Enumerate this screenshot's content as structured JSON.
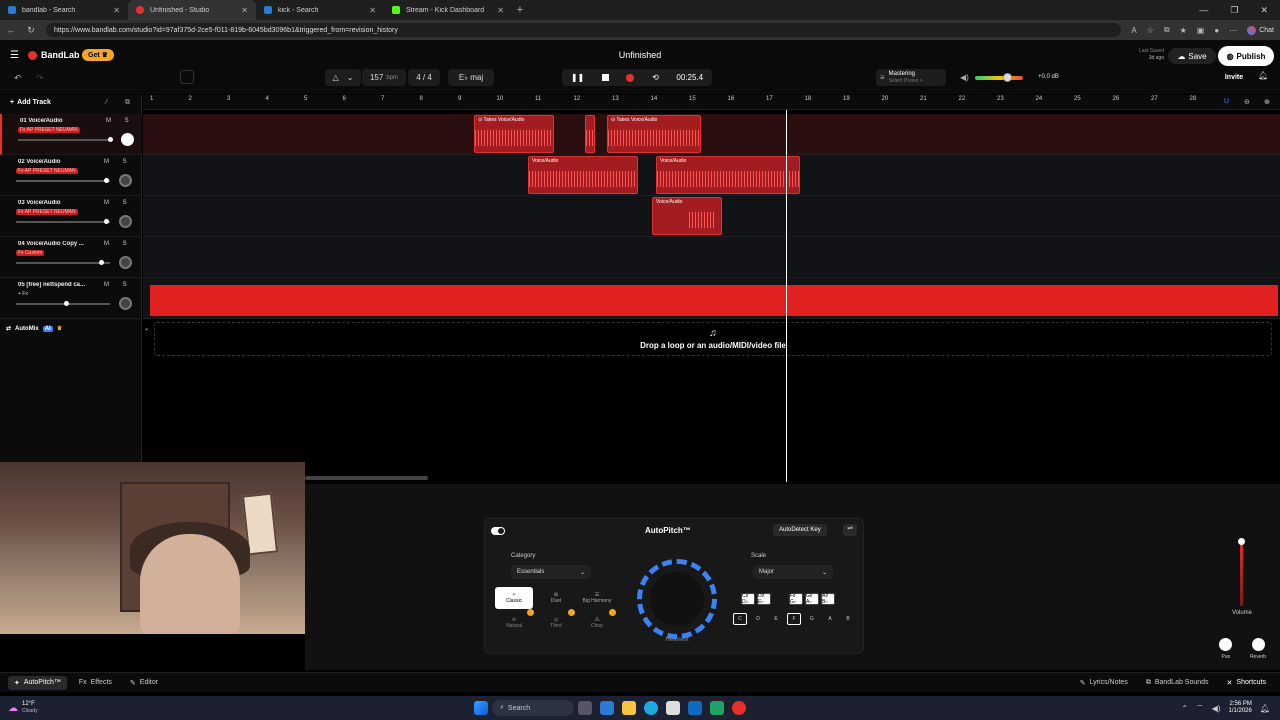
{
  "browser": {
    "tabs": [
      {
        "label": "bandlab - Search",
        "active": false
      },
      {
        "label": "Unfinished - Studio",
        "active": true
      },
      {
        "label": "kick - Search",
        "active": false
      },
      {
        "label": "Stream - Kick Dashboard",
        "active": false
      }
    ],
    "url": "https://www.bandlab.com/studio?id=97af375d-2ce5-f011-819b-6045bd3096b1&triggered_from=revision_history",
    "chat_label": "Chat"
  },
  "header": {
    "brand": "BandLab",
    "get_label": "Get",
    "project_title": "Unfinished",
    "bpm_value": "157",
    "bpm_unit": "bpm",
    "time_signature": "4 / 4",
    "key": "E♭ maj",
    "time_display": "00:25.4",
    "mastering_label": "Mastering",
    "mastering_sub": "Select Preset >",
    "master_db": "+0.0 dB",
    "last_saved_label": "Last Saved",
    "last_saved_value": "3d ago",
    "save_label": "Save",
    "publish_label": "Publish",
    "invite_label": "Invite",
    "accent": "#e5302d"
  },
  "tracks_panel": {
    "add_track_label": "Add Track",
    "tracks": [
      {
        "name": "01  Voice/Audio",
        "fx": "Fx  AP PRESET NEUMAN"
      },
      {
        "name": "02  Voice/Audio",
        "fx": "Fx  AP PRESET NEUMAN"
      },
      {
        "name": "03  Voice/Audio",
        "fx": "Fx  AP PRESET NEUMAN"
      },
      {
        "name": "04  Voice/Audio Copy ...",
        "fx": "Fx  Custom"
      },
      {
        "name": "05  [free] nettspend ca...",
        "fx": "+ Fx"
      }
    ],
    "mute_solo": "M S",
    "automix_label": "AutoMix",
    "automix_badge": "AI"
  },
  "ruler": {
    "bars": [
      "1",
      "2",
      "3",
      "4",
      "5",
      "6",
      "7",
      "8",
      "9",
      "10",
      "11",
      "12",
      "13",
      "14",
      "15",
      "16",
      "17",
      "18",
      "19",
      "20",
      "21",
      "22",
      "23",
      "24",
      "25",
      "26",
      "27",
      "28"
    ]
  },
  "clips": {
    "takes_label": "Takes",
    "voice_label": "Voice/Audio"
  },
  "dropzone": {
    "text": "Drop a loop or an audio/MIDI/video file"
  },
  "autopitch": {
    "title": "AutoPitch™",
    "autodetect_label": "AutoDetect Key",
    "category_label": "Category",
    "category_value": "Essentials",
    "scale_label": "Scale",
    "scale_value": "Major",
    "knob_caption": "Heaviest",
    "styles": [
      "Classic",
      "Duet",
      "Big Harmony",
      "Natural",
      "Third",
      "Chop"
    ],
    "keys_top": [
      "C♯ D♭",
      "D♯ E♭",
      "F♯ G♭",
      "G♯ A♭",
      "A♯ B♭"
    ],
    "keys_bottom": [
      "C",
      "D",
      "E",
      "F",
      "G",
      "A",
      "B"
    ],
    "volume_label": "Volume",
    "pan_label": "Pan",
    "reverb_label": "Reverb"
  },
  "bottom_bar": {
    "autopitch_tab": "AutoPitch™",
    "effects_tab": "Effects",
    "editor_tab": "Editor",
    "lyrics_label": "Lyrics/Notes",
    "sounds_label": "BandLab Sounds",
    "shortcuts_label": "Shortcuts"
  },
  "taskbar": {
    "weather_temp": "12°F",
    "weather_desc": "Cloudy",
    "search_label": "Search",
    "time": "2:56 PM",
    "date": "1/1/2026"
  }
}
